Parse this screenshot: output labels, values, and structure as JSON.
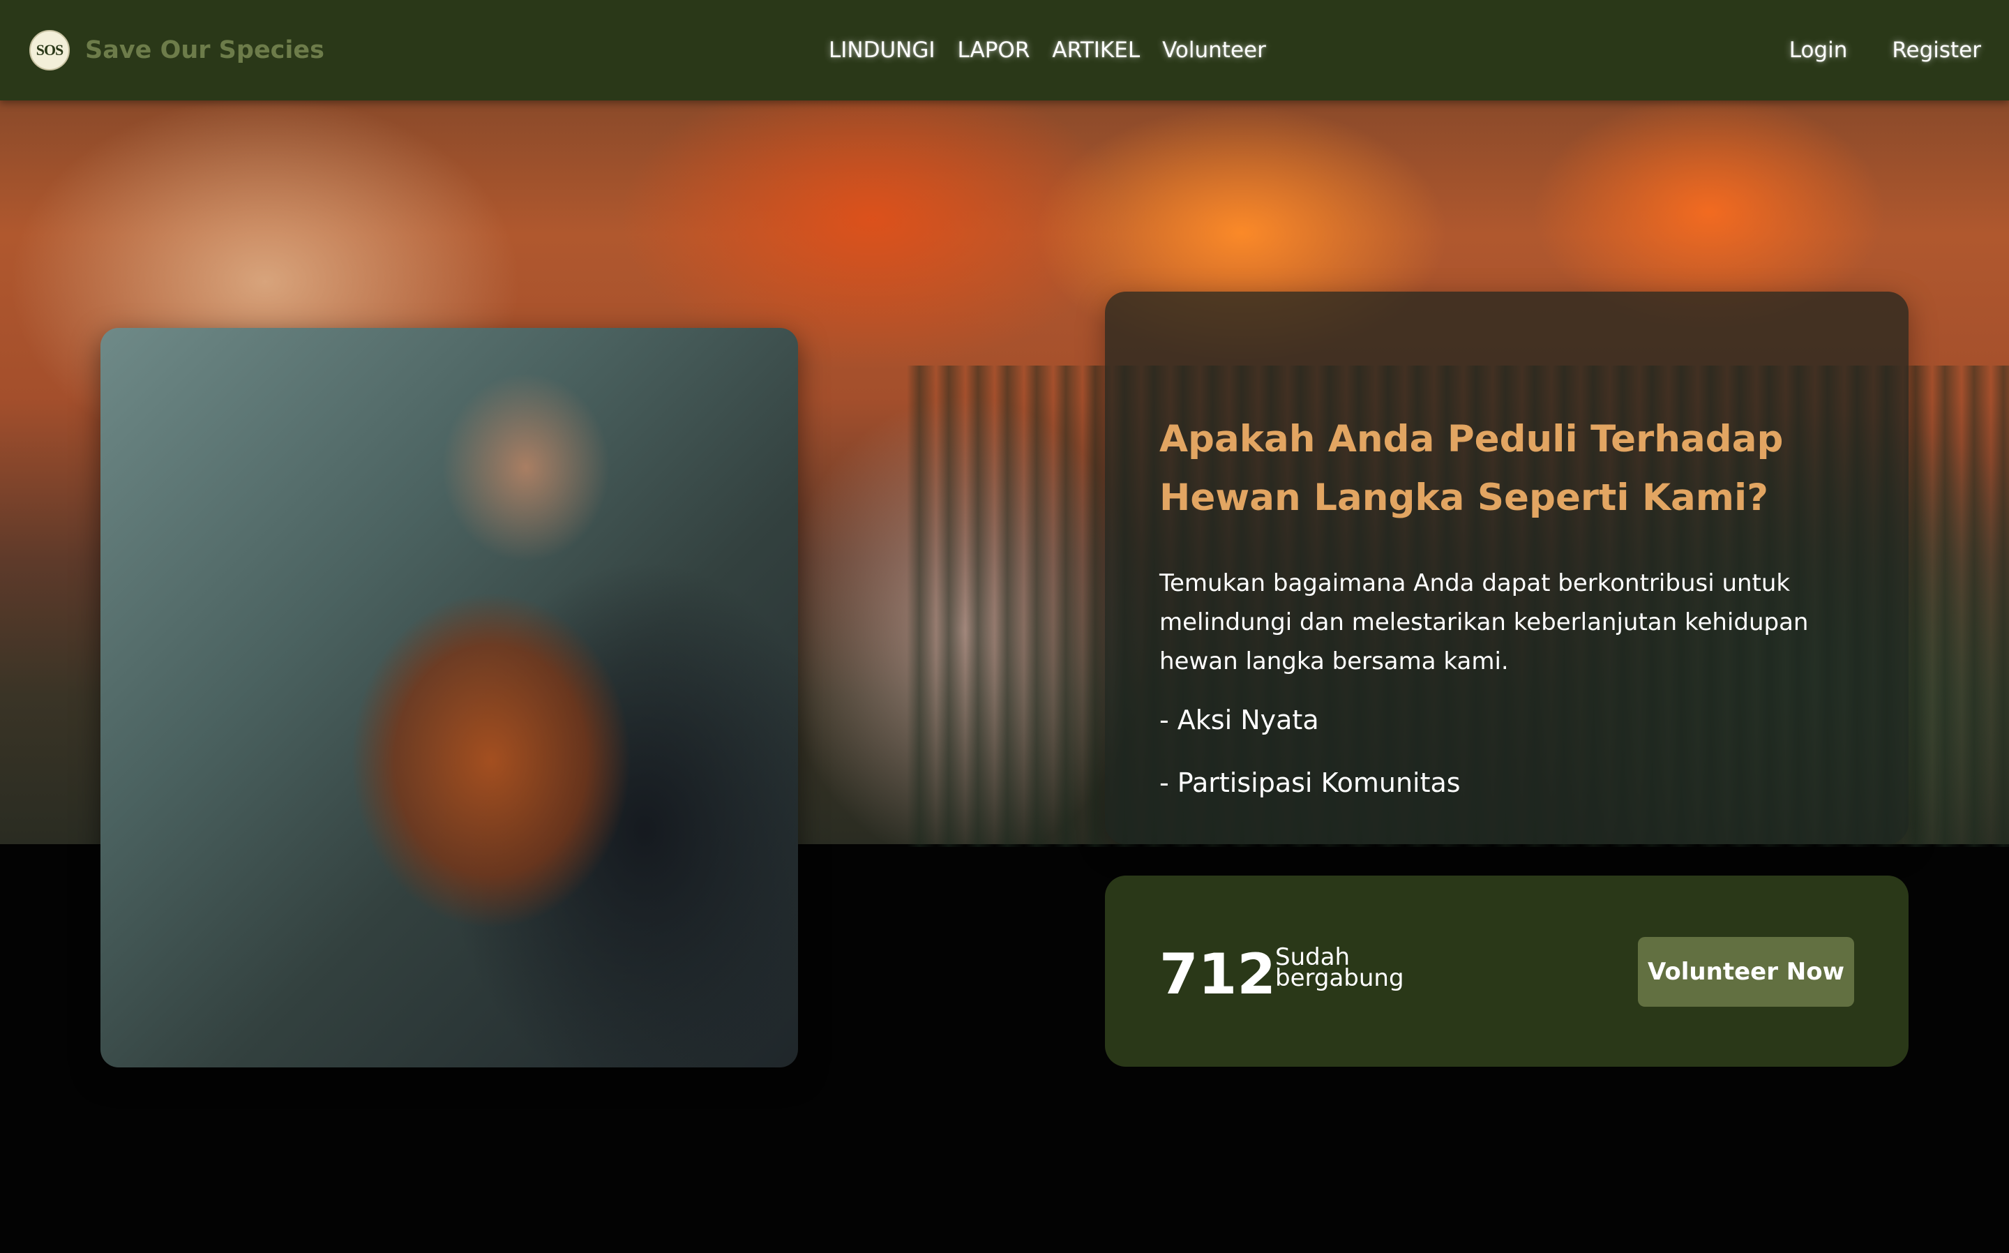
{
  "brand": {
    "logo_text": "SOS",
    "name": "Save Our Species"
  },
  "nav": {
    "links": [
      "LINDUNGI",
      "LAPOR",
      "ARTIKEL",
      "Volunteer"
    ],
    "login": "Login",
    "register": "Register"
  },
  "hero": {
    "title": "Apakah Anda Peduli Terhadap Hewan Langka Seperti Kami?",
    "description": "Temukan bagaimana Anda dapat berkontribusi untuk melindungi dan melestarikan keberlanjutan kehidupan hewan langka bersama kami.",
    "bullets": [
      "- Aksi Nyata",
      "- Partisipasi Komunitas"
    ]
  },
  "stats": {
    "count": "712",
    "label": "Sudah bergabung",
    "cta": "Volunteer Now"
  },
  "colors": {
    "nav_bg": "#2a3818",
    "accent_title": "#e2a562",
    "button": "#627041",
    "page_bg": "#030303"
  }
}
